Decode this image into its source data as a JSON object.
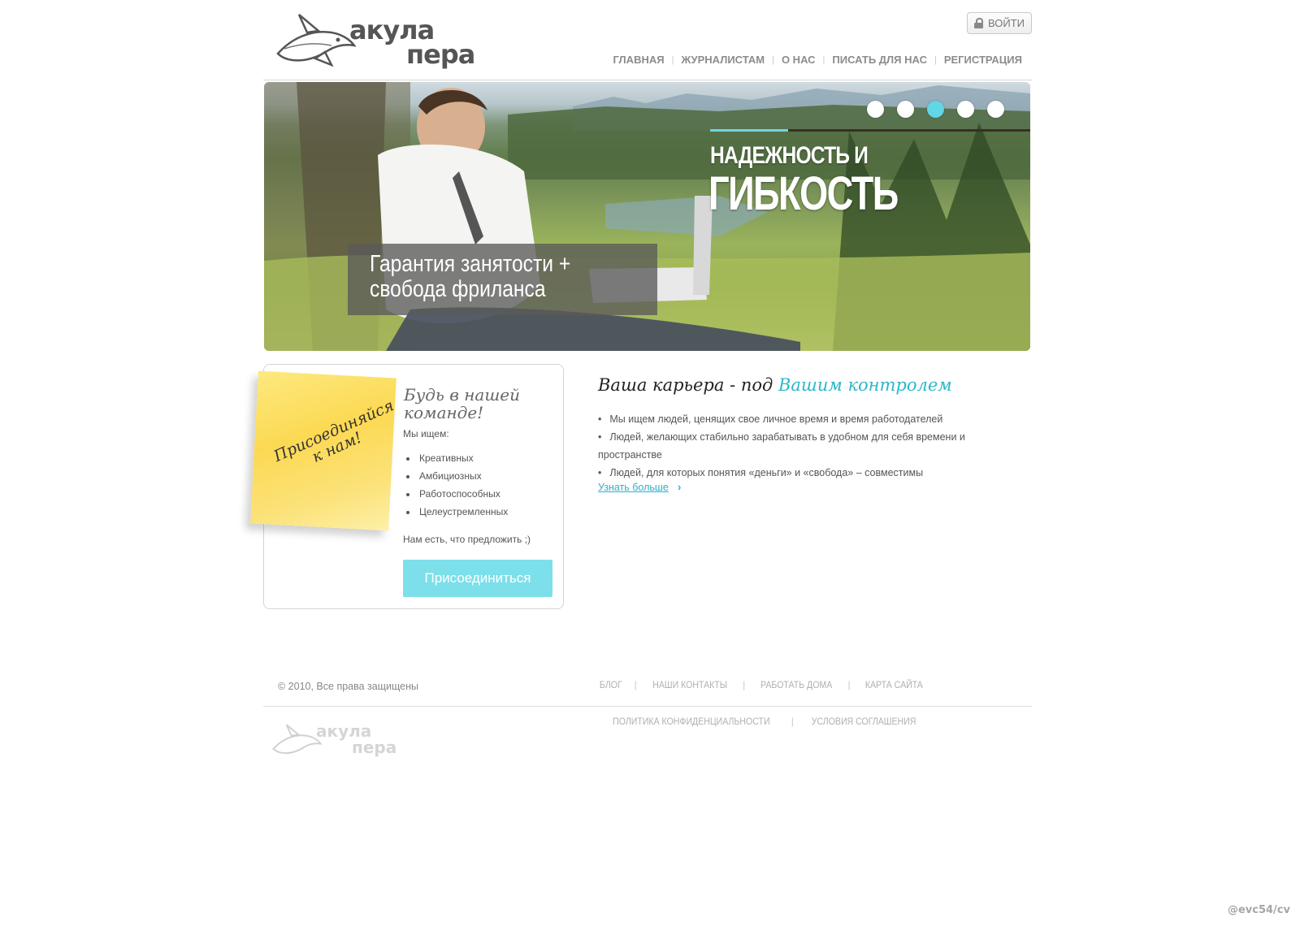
{
  "header": {
    "logo_line1": "акула",
    "logo_line2": "пера",
    "login_label": "ВОЙТИ",
    "nav": [
      "ГЛАВНАЯ",
      "ЖУРНАЛИСТАМ",
      "О НАС",
      "ПИСАТЬ ДЛЯ НАС",
      "РЕГИСТРАЦИЯ"
    ]
  },
  "banner": {
    "slides_count": 5,
    "active_slide": 3,
    "headline_small": "НАДЕЖНОСТЬ И",
    "headline_big": "ГИБКОСТЬ",
    "caption_line1": "Гарантия занятости +",
    "caption_line2": "свобода фриланса",
    "accent_color": "#61d6e5"
  },
  "join": {
    "sticky_line1": "Присоединяйся",
    "sticky_line2": "к нам!",
    "title": "Будь в нашей команде!",
    "subtitle": "Мы ищем:",
    "items": [
      "Креативных",
      "Амбициозных",
      "Работоспособных",
      "Целеустремленных"
    ],
    "note": "Нам есть, что предложить ;)",
    "button_label": "Присоединиться",
    "button_color": "#7ddfea"
  },
  "career": {
    "title_prefix": "Ваша карьера - под",
    "title_accent": "Вашим контролем",
    "items": [
      "Мы ищем людей, ценящих свое личное время и время работодателей",
      "Людей, желающих стабильно зарабатывать в удобном для себя времени и пространстве",
      "Людей, для которых понятия «деньги» и «свобода» – совместимы"
    ],
    "more_label": "Узнать больше",
    "more_arrow": "›"
  },
  "footer": {
    "copyright": "© 2010, Все права защищены",
    "nav1": [
      "БЛОГ",
      "НАШИ КОНТАКТЫ",
      "РАБОТАТЬ ДОМА",
      "КАРТА САЙТА"
    ],
    "nav2": [
      "ПОЛИТИКА КОНФИДЕНЦИАЛЬНОСТИ",
      "УСЛОВИЯ СОГЛАШЕНИЯ"
    ],
    "logo_line1": "акула",
    "logo_line2": "пера"
  },
  "watermark": "@evc54/cv"
}
